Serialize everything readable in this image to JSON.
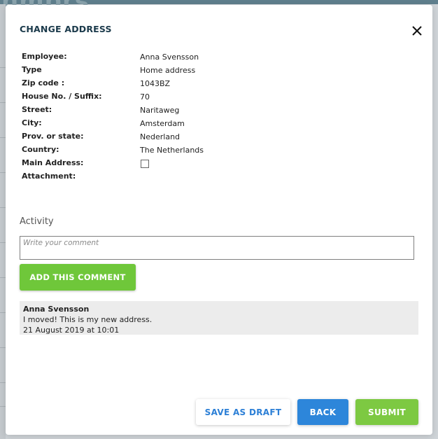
{
  "background": {
    "brand_text": "nmbrs"
  },
  "modal": {
    "title": "CHANGE ADDRESS",
    "close_icon": "close-icon"
  },
  "details": [
    {
      "label": "Employee:",
      "value": "Anna Svensson"
    },
    {
      "label": "Type",
      "value": "Home address"
    },
    {
      "label": "Zip code :",
      "value": "1043BZ"
    },
    {
      "label": "House No. / Suffix:",
      "value": "70"
    },
    {
      "label": "Street:",
      "value": "Naritaweg"
    },
    {
      "label": "City:",
      "value": "Amsterdam"
    },
    {
      "label": "Prov. or state:",
      "value": "Nederland"
    },
    {
      "label": "Country:",
      "value": "The Netherlands"
    },
    {
      "label": "Main Address:",
      "checked": false
    },
    {
      "label": "Attachment:",
      "value": ""
    }
  ],
  "activity": {
    "title": "Activity",
    "comment_placeholder": "Write your comment",
    "comment_value": "",
    "add_button": "ADD THIS COMMENT",
    "comments": [
      {
        "author": "Anna Svensson",
        "text": "I moved! This is my new address.",
        "timestamp": "21 August 2019 at 10:01"
      }
    ]
  },
  "footer": {
    "save_draft": "SAVE AS DRAFT",
    "back": "BACK",
    "submit": "SUBMIT"
  },
  "colors": {
    "title": "#1b3a4b",
    "add_comment_green": "#6fc73a",
    "submit_green": "#7dc942",
    "back_blue": "#2d86da",
    "draft_text_blue": "#2c7fd6"
  }
}
